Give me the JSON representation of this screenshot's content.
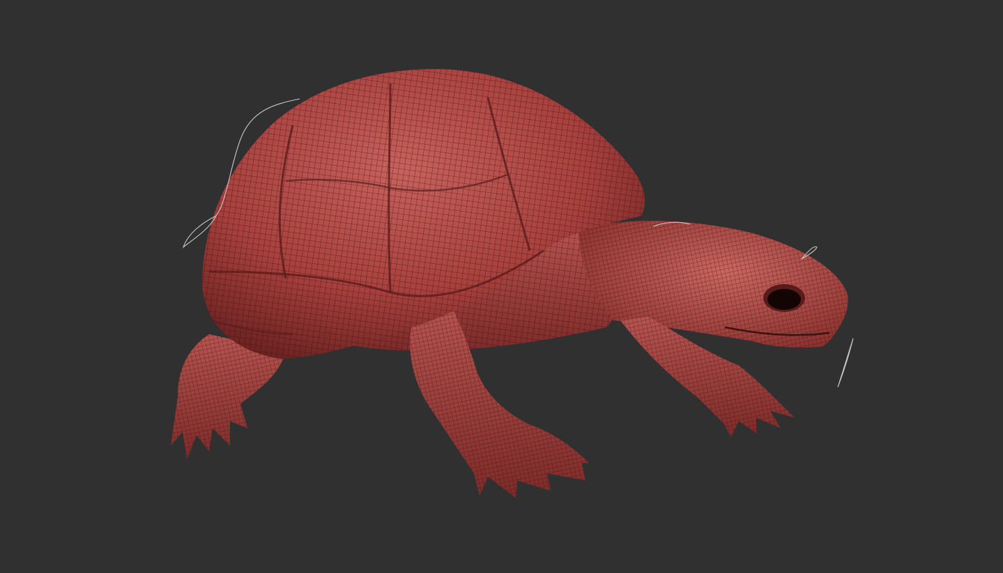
{
  "viewport": {
    "background_color": "#303030",
    "model_name": "turtle",
    "render_mode": "polyframe-wireframe",
    "surface_color": "#a8403d",
    "wire_color": "#3a1414",
    "curve_color": "#c8c8c8"
  }
}
